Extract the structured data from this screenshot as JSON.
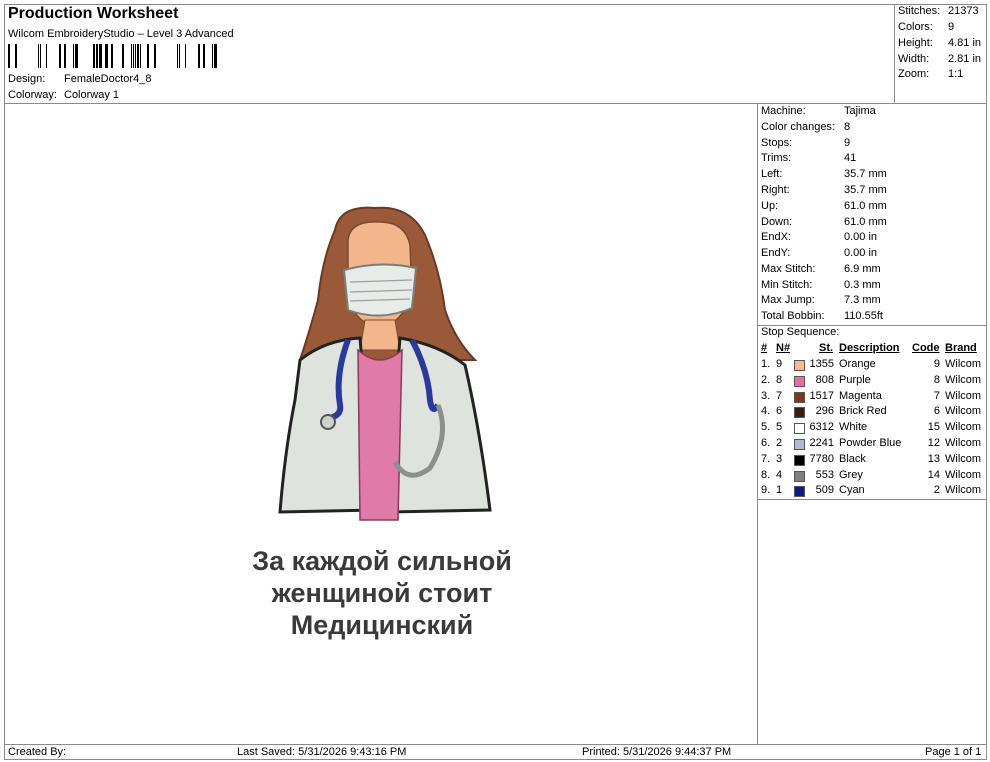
{
  "header": {
    "title": "Production Worksheet",
    "software": "Wilcom EmbroideryStudio – Level 3 Advanced",
    "design_label": "Design:",
    "design_value": "FemaleDoctor4_8",
    "colorway_label": "Colorway:",
    "colorway_value": "Colorway 1"
  },
  "summary": {
    "stitches_label": "Stitches:",
    "stitches": "21373",
    "colors_label": "Colors:",
    "colors": "9",
    "height_label": "Height:",
    "height": "4.81 in",
    "width_label": "Width:",
    "width": "2.81 in",
    "zoom_label": "Zoom:",
    "zoom": "1:1"
  },
  "machine_info": [
    {
      "label": "Machine:",
      "value": "Tajima"
    },
    {
      "label": "Color changes:",
      "value": "8"
    },
    {
      "label": "Stops:",
      "value": "9"
    },
    {
      "label": "Trims:",
      "value": "41"
    },
    {
      "label": "Left:",
      "value": "35.7 mm"
    },
    {
      "label": "Right:",
      "value": "35.7 mm"
    },
    {
      "label": "Up:",
      "value": "61.0 mm"
    },
    {
      "label": "Down:",
      "value": "61.0 mm"
    },
    {
      "label": "EndX:",
      "value": "0.00 in"
    },
    {
      "label": "EndY:",
      "value": "0.00 in"
    },
    {
      "label": "Max Stitch:",
      "value": "6.9 mm"
    },
    {
      "label": "Min Stitch:",
      "value": "0.3 mm"
    },
    {
      "label": "Max Jump:",
      "value": "7.3 mm"
    },
    {
      "label": "Total Bobbin:",
      "value": "110.55ft"
    }
  ],
  "stop_sequence": {
    "title": "Stop Sequence:",
    "headers": {
      "num": "#",
      "n": "N#",
      "st": "St.",
      "description": "Description",
      "code": "Code",
      "brand": "Brand"
    },
    "rows": [
      {
        "num": "1.",
        "n": "9",
        "color": "#f4b99a",
        "st": "1355",
        "description": "Orange",
        "code": "9",
        "brand": "Wilcom"
      },
      {
        "num": "2.",
        "n": "8",
        "color": "#e0709e",
        "st": "808",
        "description": "Purple",
        "code": "8",
        "brand": "Wilcom"
      },
      {
        "num": "3.",
        "n": "7",
        "color": "#7a3a22",
        "st": "1517",
        "description": "Magenta",
        "code": "7",
        "brand": "Wilcom"
      },
      {
        "num": "4.",
        "n": "6",
        "color": "#3a1c12",
        "st": "296",
        "description": "Brick Red",
        "code": "6",
        "brand": "Wilcom"
      },
      {
        "num": "5.",
        "n": "5",
        "color": "#ffffff",
        "st": "6312",
        "description": "White",
        "code": "15",
        "brand": "Wilcom"
      },
      {
        "num": "6.",
        "n": "2",
        "color": "#b4b8d4",
        "st": "2241",
        "description": "Powder Blue",
        "code": "12",
        "brand": "Wilcom"
      },
      {
        "num": "7.",
        "n": "3",
        "color": "#000000",
        "st": "7780",
        "description": "Black",
        "code": "13",
        "brand": "Wilcom"
      },
      {
        "num": "8.",
        "n": "4",
        "color": "#808080",
        "st": "553",
        "description": "Grey",
        "code": "14",
        "brand": "Wilcom"
      },
      {
        "num": "9.",
        "n": "1",
        "color": "#0a1a8c",
        "st": "509",
        "description": "Cyan",
        "code": "2",
        "brand": "Wilcom"
      }
    ]
  },
  "design_caption": {
    "line1": "За каждой сильной",
    "line2": "женщиной стоит",
    "line3": "Медицинский"
  },
  "footer": {
    "created_by": "Created By:",
    "last_saved": "Last Saved: 5/31/2026 9:43:16 PM",
    "printed": "Printed: 5/31/2026 9:44:37 PM",
    "page": "Page 1 of 1"
  }
}
